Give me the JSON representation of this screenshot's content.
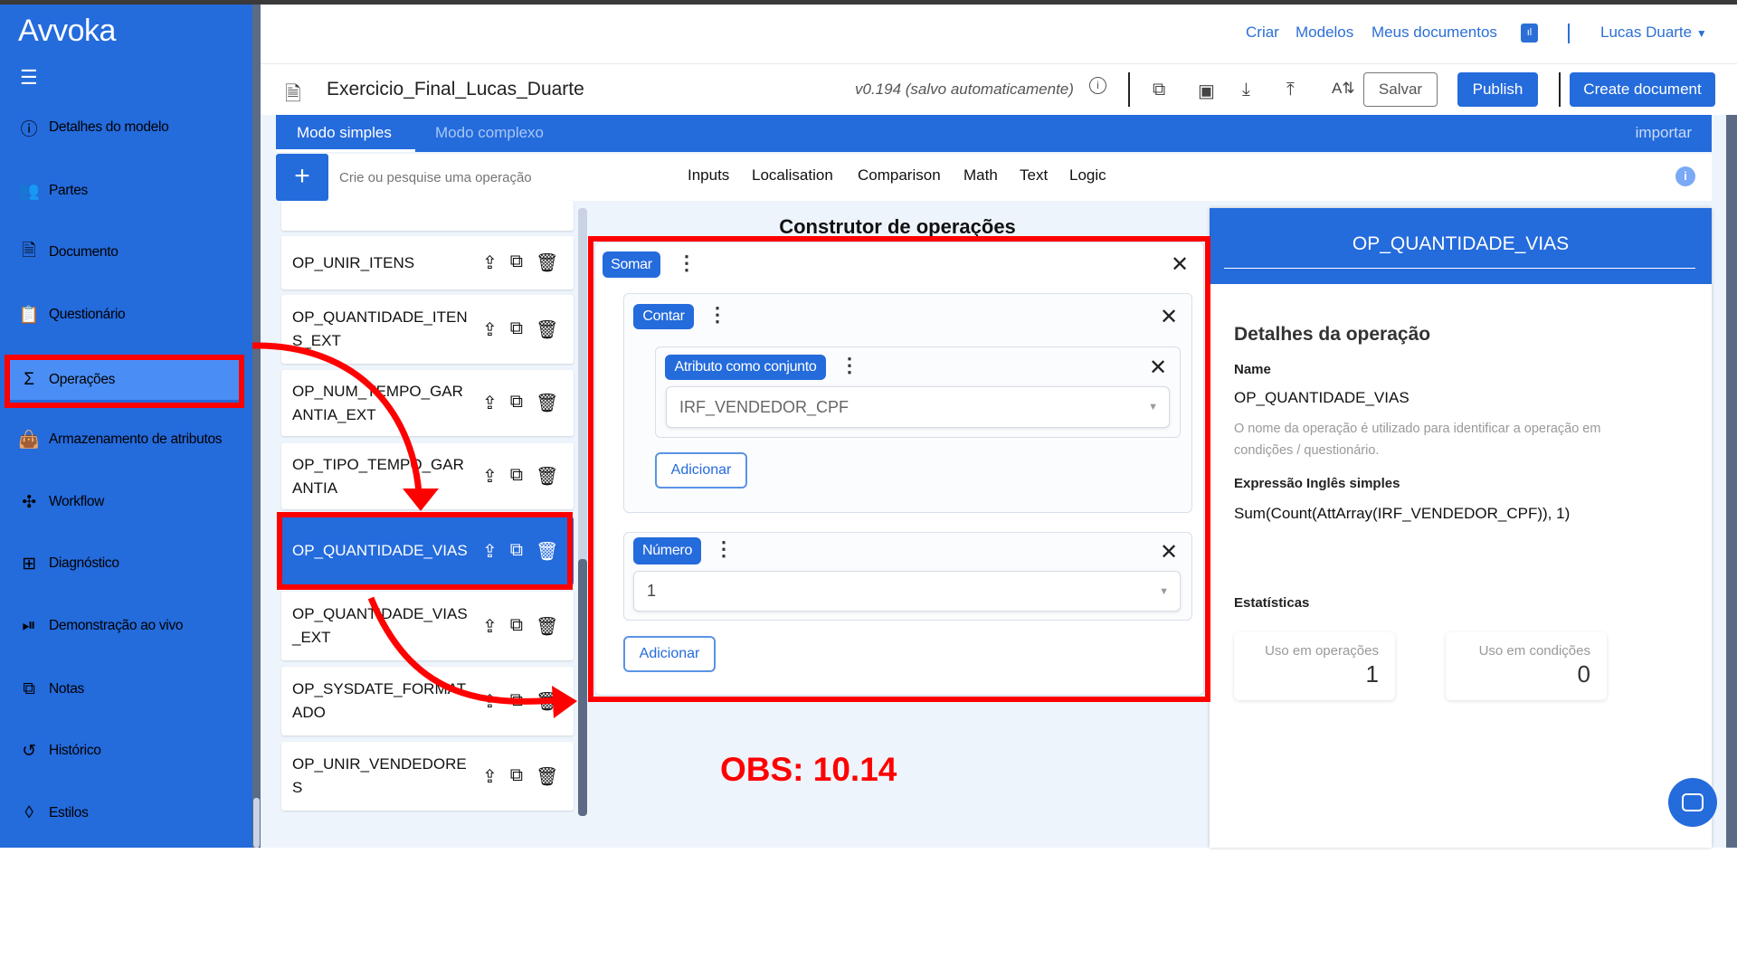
{
  "sidebar": {
    "logo": "Avvoka",
    "items": [
      {
        "label": "Detalhes do modelo",
        "icon": "info-icon"
      },
      {
        "label": "Partes",
        "icon": "users-icon"
      },
      {
        "label": "Documento",
        "icon": "document-icon"
      },
      {
        "label": "Questionário",
        "icon": "clipboard-icon"
      },
      {
        "label": "Operações",
        "icon": "sigma-icon",
        "active": true
      },
      {
        "label": "Armazenamento de atributos",
        "icon": "bag-icon"
      },
      {
        "label": "Workflow",
        "icon": "workflow-icon"
      },
      {
        "label": "Diagnóstico",
        "icon": "plus-square-icon"
      },
      {
        "label": "Demonstração ao vivo",
        "icon": "play-pause-icon"
      },
      {
        "label": "Notas",
        "icon": "notes-icon"
      },
      {
        "label": "Histórico",
        "icon": "history-icon"
      },
      {
        "label": "Estilos",
        "icon": "styles-icon"
      }
    ]
  },
  "header": {
    "links": [
      "Criar",
      "Modelos",
      "Meus documentos"
    ],
    "user": "Lucas Duarte",
    "doc_title": "Exercicio_Final_Lucas_Duarte",
    "version": "v0.194 (salvo automaticamente)",
    "save": "Salvar",
    "publish": "Publish",
    "create": "Create document"
  },
  "tabs": {
    "simple": "Modo simples",
    "complex": "Modo complexo",
    "import": "importar"
  },
  "search": {
    "placeholder": "Crie ou pesquise uma operação",
    "categories": [
      "Inputs",
      "Localisation",
      "Comparison",
      "Math",
      "Text",
      "Logic"
    ]
  },
  "operations": [
    "OP_UNIR_ITENS",
    "OP_QUANTIDADE_ITENS_EXT",
    "OP_NUM_TEMPO_GARANTIA_EXT",
    "OP_TIPO_TEMPO_GARANTIA",
    "OP_QUANTIDADE_VIAS",
    "OP_QUANTIDADE_VIAS_EXT",
    "OP_SYSDATE_FORMATADO",
    "OP_UNIR_VENDEDORES"
  ],
  "selected_operation": "OP_QUANTIDADE_VIAS",
  "builder": {
    "title": "Construtor de operações",
    "sum": "Somar",
    "count": "Contar",
    "attr": "Atributo como conjunto",
    "attr_value": "IRF_VENDEDOR_CPF",
    "add": "Adicionar",
    "number": "Número",
    "number_value": "1"
  },
  "details": {
    "header": "OP_QUANTIDADE_VIAS",
    "heading": "Detalhes da operação",
    "name_label": "Name",
    "name": "OP_QUANTIDADE_VIAS",
    "help": "O nome da operação é utilizado para identificar a operação em condições / questionário.",
    "expr_label": "Expressão Inglês simples",
    "expr": "Sum(Count(AttArray(IRF_VENDEDOR_CPF)), 1)",
    "stats_label": "Estatísticas",
    "stat_ops_label": "Uso em operações",
    "stat_ops": "1",
    "stat_cond_label": "Uso em condições",
    "stat_cond": "0"
  },
  "annotation": {
    "text": "OBS: 10.14",
    "color": "#ff0000"
  },
  "colors": {
    "brand": "#246bdc",
    "active": "#4a8ef5"
  }
}
